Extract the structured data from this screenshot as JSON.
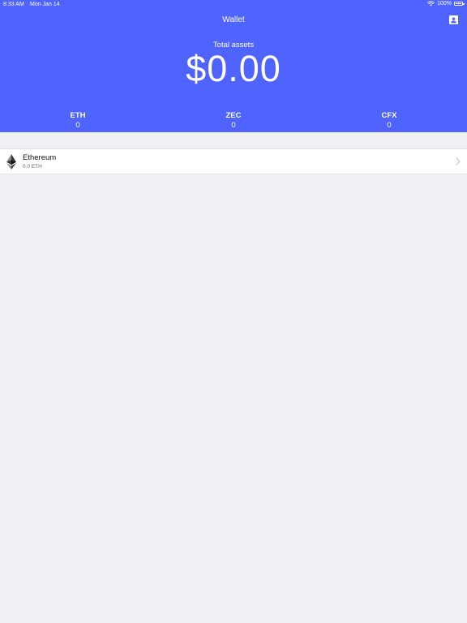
{
  "status_bar": {
    "time": "8:33 AM",
    "date": "Mon Jan 14",
    "battery": "100%",
    "icons": [
      "wifi-icon",
      "battery-icon"
    ]
  },
  "nav": {
    "title": "Wallet",
    "account_icon": "contact-card-icon"
  },
  "summary": {
    "label": "Total assets",
    "value": "$0.00"
  },
  "coins": [
    {
      "symbol": "ETH",
      "amount": "0"
    },
    {
      "symbol": "ZEC",
      "amount": "0"
    },
    {
      "symbol": "CFX",
      "amount": "0"
    }
  ],
  "assets": [
    {
      "name": "Ethereum",
      "balance": "0.0 ETH",
      "icon": "ethereum-logo-icon"
    }
  ],
  "colors": {
    "header_bg": "#4f63ff",
    "page_bg": "#efeff4",
    "row_bg": "#ffffff",
    "text_on_header": "#ffffff"
  }
}
